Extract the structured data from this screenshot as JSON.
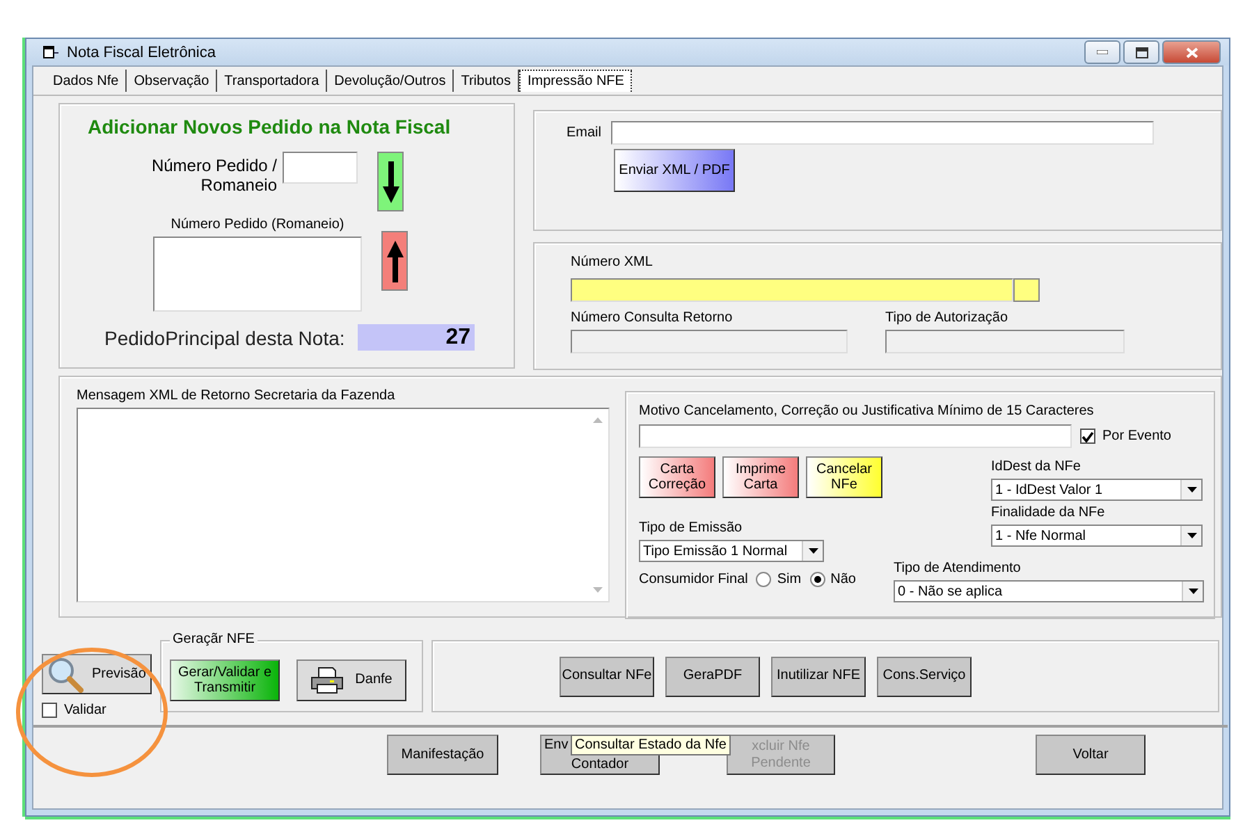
{
  "window": {
    "title": "Nota Fiscal Eletrônica"
  },
  "tabs": [
    {
      "label": "Dados Nfe",
      "selected": false
    },
    {
      "label": "Observação",
      "selected": false
    },
    {
      "label": "Transportadora",
      "selected": false
    },
    {
      "label": "Devolução/Outros",
      "selected": false
    },
    {
      "label": "Tributos",
      "selected": false
    },
    {
      "label": "Impressão NFE",
      "selected": true
    }
  ],
  "pedido_panel": {
    "title": "Adicionar Novos Pedido na Nota Fiscal",
    "numero_label": "Número Pedido /\nRomaneio",
    "list_label": "Número Pedido (Romaneio)",
    "principal_label": "PedidoPrincipal desta Nota:",
    "principal_value": "27"
  },
  "email_panel": {
    "label": "Email",
    "button": "Enviar XML / PDF"
  },
  "xml_panel": {
    "numero_xml_label": "Número XML",
    "consulta_label": "Número Consulta Retorno",
    "autorizacao_label": "Tipo de Autorização"
  },
  "mensagem": {
    "label": "Mensagem XML de Retorno Secretaria da Fazenda"
  },
  "cancel_panel": {
    "motivo_label": "Motivo Cancelamento, Correção ou Justificativa Mínimo de 15 Caracteres",
    "por_evento": {
      "label": "Por Evento",
      "checked": true
    },
    "buttons": [
      {
        "label": "Carta\nCorreção",
        "color": "#f47c7c"
      },
      {
        "label": "Imprime\nCarta",
        "color": "#f47c7c"
      },
      {
        "label": "Cancelar\nNFe",
        "color": "#ffff30"
      }
    ],
    "id_dest": {
      "label": "IdDest da NFe",
      "value": "1 - IdDest Valor 1"
    },
    "finalidade": {
      "label": "Finalidade da NFe",
      "value": "1 - Nfe Normal"
    },
    "tipo_emissao": {
      "label": "Tipo de Emissão",
      "value": "Tipo Emissão 1 Normal"
    },
    "tipo_atendimento": {
      "label": "Tipo de Atendimento",
      "value": "0 - Não se aplica"
    },
    "consumidor_final": {
      "label": "Consumidor Final",
      "options": [
        {
          "label": "Sim",
          "selected": false
        },
        {
          "label": "Não",
          "selected": true
        }
      ]
    }
  },
  "preview": {
    "button": "Previsão",
    "validar": {
      "label": "Validar",
      "checked": false
    }
  },
  "geracao": {
    "title": "Geraçãr NFE",
    "transmit_button": "Gerar/Validar e\nTransmitir",
    "danfe_button": "Danfe"
  },
  "service_buttons": [
    "Consultar NFe",
    "GeraPDF",
    "Inutilizar NFE",
    "Cons.Serviço"
  ],
  "footer_buttons": [
    {
      "label": "Manifestação",
      "kind": "plain",
      "disabled": false
    },
    {
      "label": "Env\nContador",
      "kind": "clipped",
      "disabled": false
    },
    {
      "label": "xcluir Nfe\nPendente",
      "kind": "plain",
      "disabled": true
    },
    {
      "label": "Voltar",
      "kind": "plain",
      "disabled": false
    }
  ],
  "tooltip": "Consultar Estado da Nfe"
}
